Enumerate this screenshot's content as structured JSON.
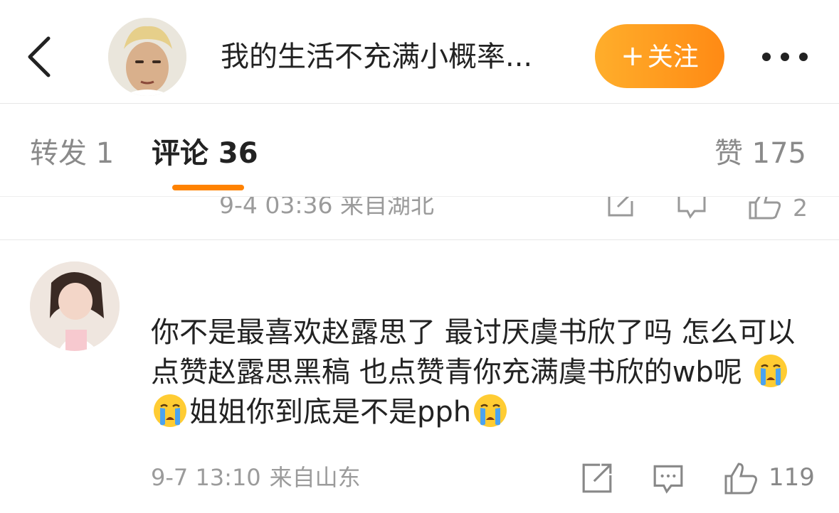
{
  "header": {
    "title": "我的生活不充满小概率...",
    "follow_label": "关注",
    "follow_plus": "+",
    "accent_color": "#ff8a14"
  },
  "tabs": {
    "repost": "转发 1",
    "comment": "评论 36",
    "like": "赞 175"
  },
  "previous_comment": {
    "time": "9-4 03:36",
    "location": "来自湖北",
    "likes": "2"
  },
  "comment": {
    "text_part1": "你不是最喜欢赵露思了 最讨厌虞书欣了吗 怎么可以点赞赵露思黑稿 也点赞青你充满虞书欣的wb呢",
    "text_part2": "姐姐你到底是不是pph",
    "emoji": "crying-face-icon",
    "time": "9-7 13:10",
    "location": "来自山东",
    "likes": "119"
  }
}
